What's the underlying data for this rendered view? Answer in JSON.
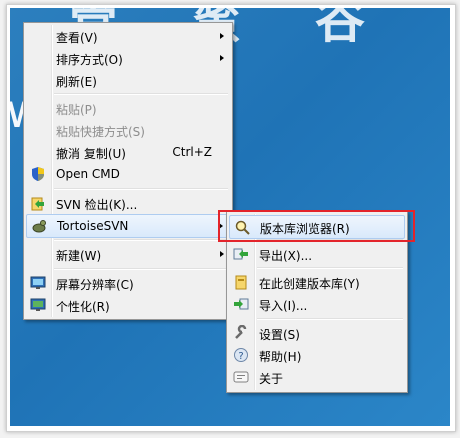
{
  "watermark": {
    "top": "管 蜜 谷",
    "domain": "w          t.cn"
  },
  "context_menu": {
    "items": [
      {
        "label": "查看(V)"
      },
      {
        "label": "排序方式(O)"
      },
      {
        "label": "刷新(E)"
      },
      {
        "label": "粘贴(P)"
      },
      {
        "label": "粘贴快捷方式(S)"
      },
      {
        "label": "撤消 复制(U)",
        "shortcut": "Ctrl+Z"
      },
      {
        "label": "Open CMD"
      },
      {
        "label": "SVN 检出(K)..."
      },
      {
        "label": "TortoiseSVN"
      },
      {
        "label": "新建(W)"
      },
      {
        "label": "屏幕分辨率(C)"
      },
      {
        "label": "个性化(R)"
      }
    ]
  },
  "submenu": {
    "items": [
      {
        "label": "版本库浏览器(R)"
      },
      {
        "label": "导出(X)..."
      },
      {
        "label": "在此创建版本库(Y)"
      },
      {
        "label": "导入(I)..."
      },
      {
        "label": "设置(S)"
      },
      {
        "label": "帮助(H)"
      },
      {
        "label": "关于"
      }
    ]
  },
  "colors": {
    "desktop": "#2178b8",
    "highlight_box": "#e3242b",
    "hover": "#d9e9fb"
  }
}
